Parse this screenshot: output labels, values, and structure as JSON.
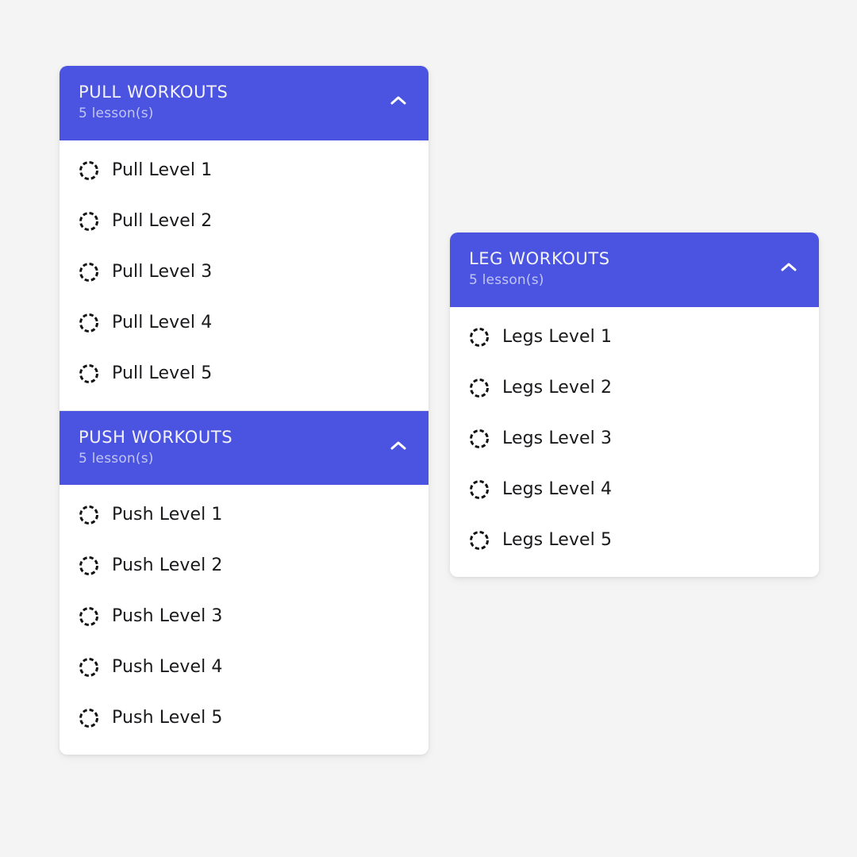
{
  "theme": {
    "accent": "#4a54e1",
    "page_background": "#f4f4f4",
    "card_background": "#ffffff",
    "lesson_text": "#19191c",
    "header_title": "#f2f2f7",
    "header_subtitle": "rgba(255,255,255,0.66)",
    "status_icon": "#111111"
  },
  "cards": [
    {
      "id": "left",
      "sections": [
        {
          "title": "PULL WORKOUTS",
          "subtitle": "5 lesson(s)",
          "toggle_icon": "chevron-up-icon",
          "expanded": true,
          "lessons": [
            {
              "label": "Pull Level 1",
              "status_icon": "dashed-circle-icon"
            },
            {
              "label": "Pull Level 2",
              "status_icon": "dashed-circle-icon"
            },
            {
              "label": "Pull Level 3",
              "status_icon": "dashed-circle-icon"
            },
            {
              "label": "Pull Level 4",
              "status_icon": "dashed-circle-icon"
            },
            {
              "label": "Pull Level 5",
              "status_icon": "dashed-circle-icon"
            }
          ]
        },
        {
          "title": "PUSH WORKOUTS",
          "subtitle": "5 lesson(s)",
          "toggle_icon": "chevron-up-icon",
          "expanded": true,
          "lessons": [
            {
              "label": "Push Level 1",
              "status_icon": "dashed-circle-icon"
            },
            {
              "label": "Push Level 2",
              "status_icon": "dashed-circle-icon"
            },
            {
              "label": "Push Level 3",
              "status_icon": "dashed-circle-icon"
            },
            {
              "label": "Push Level 4",
              "status_icon": "dashed-circle-icon"
            },
            {
              "label": "Push Level 5",
              "status_icon": "dashed-circle-icon"
            }
          ]
        }
      ]
    },
    {
      "id": "right",
      "sections": [
        {
          "title": "LEG WORKOUTS",
          "subtitle": "5 lesson(s)",
          "toggle_icon": "chevron-up-icon",
          "expanded": true,
          "lessons": [
            {
              "label": "Legs Level 1",
              "status_icon": "dashed-circle-icon"
            },
            {
              "label": "Legs Level 2",
              "status_icon": "dashed-circle-icon"
            },
            {
              "label": "Legs Level 3",
              "status_icon": "dashed-circle-icon"
            },
            {
              "label": "Legs Level 4",
              "status_icon": "dashed-circle-icon"
            },
            {
              "label": "Legs Level 5",
              "status_icon": "dashed-circle-icon"
            }
          ]
        }
      ]
    }
  ]
}
